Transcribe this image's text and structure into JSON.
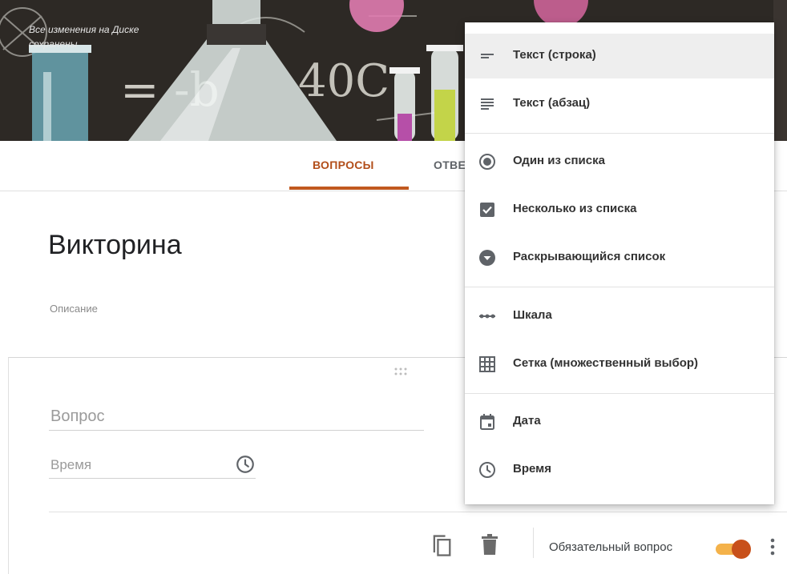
{
  "header": {
    "save_status": "Все изменения на Диске\nсохранены",
    "image_chalk_text": [
      "= -b",
      "40C"
    ]
  },
  "tabs": [
    {
      "label": "ВОПРОСЫ",
      "active": true
    },
    {
      "label": "ОТВЕТЫ",
      "active": false
    }
  ],
  "form": {
    "title": "Викторина",
    "description_placeholder": "Описание"
  },
  "question": {
    "question_placeholder": "Вопрос",
    "answer_placeholder": "Время",
    "answer_icon": "clock-icon",
    "required_label": "Обязательный вопрос",
    "required_on": true
  },
  "type_menu": {
    "items": [
      {
        "label": "Текст (строка)",
        "icon": "short-text-icon",
        "highlighted": true
      },
      {
        "label": "Текст (абзац)",
        "icon": "paragraph-icon"
      },
      {
        "label": "Один из списка",
        "icon": "radio-icon"
      },
      {
        "label": "Несколько из списка",
        "icon": "checkbox-icon"
      },
      {
        "label": "Раскрывающийся список",
        "icon": "dropdown-icon"
      },
      {
        "label": "Шкала",
        "icon": "linear-scale-icon"
      },
      {
        "label": "Сетка (множественный выбор)",
        "icon": "grid-icon"
      },
      {
        "label": "Дата",
        "icon": "calendar-icon"
      },
      {
        "label": "Время",
        "icon": "clock-icon"
      }
    ]
  },
  "colors": {
    "accent": "#c1591f",
    "toggle_track": "#f4b24a",
    "toggle_thumb": "#c8501a"
  }
}
